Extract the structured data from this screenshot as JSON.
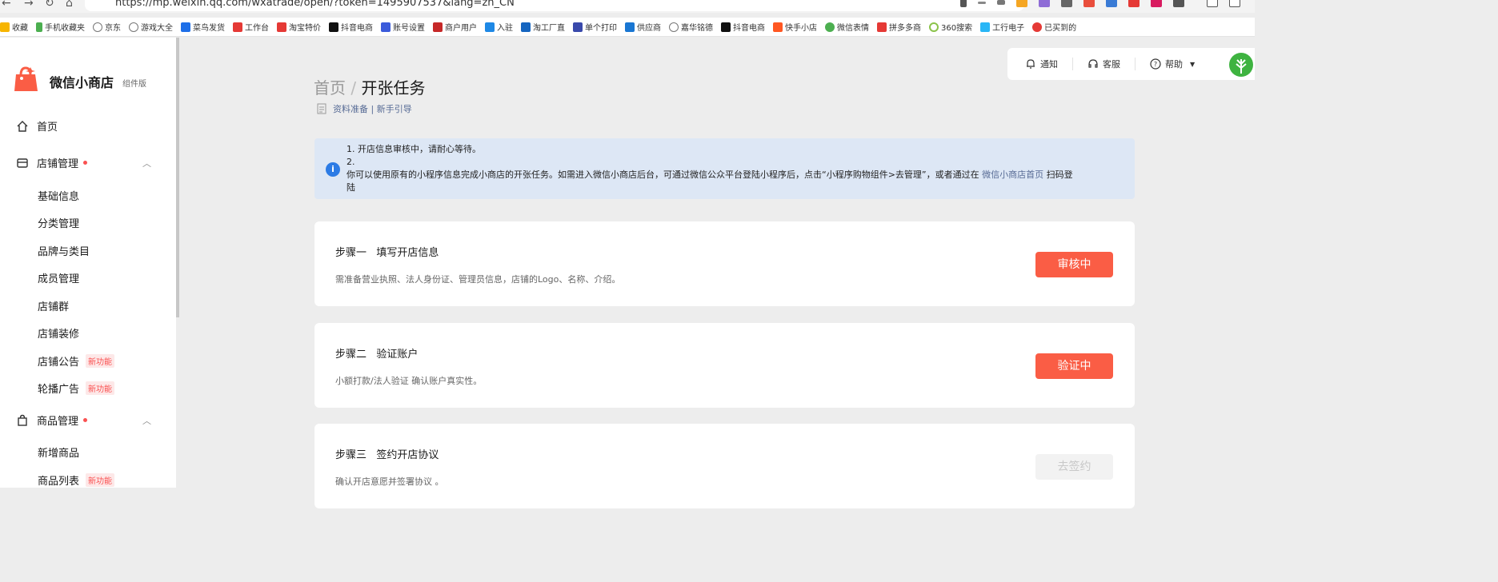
{
  "browser": {
    "url": "https://mp.weixin.qq.com/wxatrade/open/?token=1495907537&lang=zh_CN",
    "bookmarks": [
      "收藏",
      "手机收藏夹",
      "京东",
      "游戏大全",
      "菜鸟发货",
      "工作台",
      "淘宝特价",
      "抖音电商",
      "账号设置",
      "商户用户",
      "入驻",
      "淘工厂直",
      "单个打印",
      "供应商",
      "嘉华铭德",
      "抖音电商",
      "快手小店",
      "微信表情",
      "拼多多商",
      "360搜索",
      "工行电子",
      "已买到的"
    ]
  },
  "sidebar": {
    "brand": "微信小商店",
    "brand_sub": "组件版",
    "home": "首页",
    "store_mgmt": "店铺管理",
    "store_items": [
      "基础信息",
      "分类管理",
      "品牌与类目",
      "成员管理",
      "店铺群",
      "店铺装修",
      "店铺公告",
      "轮播广告"
    ],
    "new_tag": "新功能",
    "goods_mgmt": "商品管理",
    "goods_items": [
      "新增商品",
      "商品列表"
    ]
  },
  "topbar": {
    "notify": "通知",
    "service": "客服",
    "help": "帮助"
  },
  "main": {
    "crumb_home": "首页",
    "crumb_sep": "/",
    "crumb_current": "开张任务",
    "guide_links": "资料准备 | 新手引导",
    "notice_line1": "1. 开店信息审核中，请耐心等待。",
    "notice_line2": "2.",
    "notice_line3_a": "你可以使用原有的小程序信息完成小商店的开张任务。如需进入微信小商店后台，可通过微信公众平台登陆小程序后，点击“小程序购物组件>去管理”，或者通过在",
    "notice_link": "微信小商店首页",
    "notice_line3_b": "扫码登",
    "notice_line4": "陆",
    "steps": [
      {
        "title": "步骤一   填写开店信息",
        "desc": "需准备营业执照、法人身份证、管理员信息，店铺的Logo、名称、介绍。",
        "button": "审核中"
      },
      {
        "title": "步骤二   验证账户",
        "desc": "小额打款/法人验证 确认账户真实性。",
        "button": "验证中"
      },
      {
        "title": "步骤三   签约开店协议",
        "desc": "确认开店意愿并签署协议 。",
        "button": "去签约"
      }
    ]
  }
}
